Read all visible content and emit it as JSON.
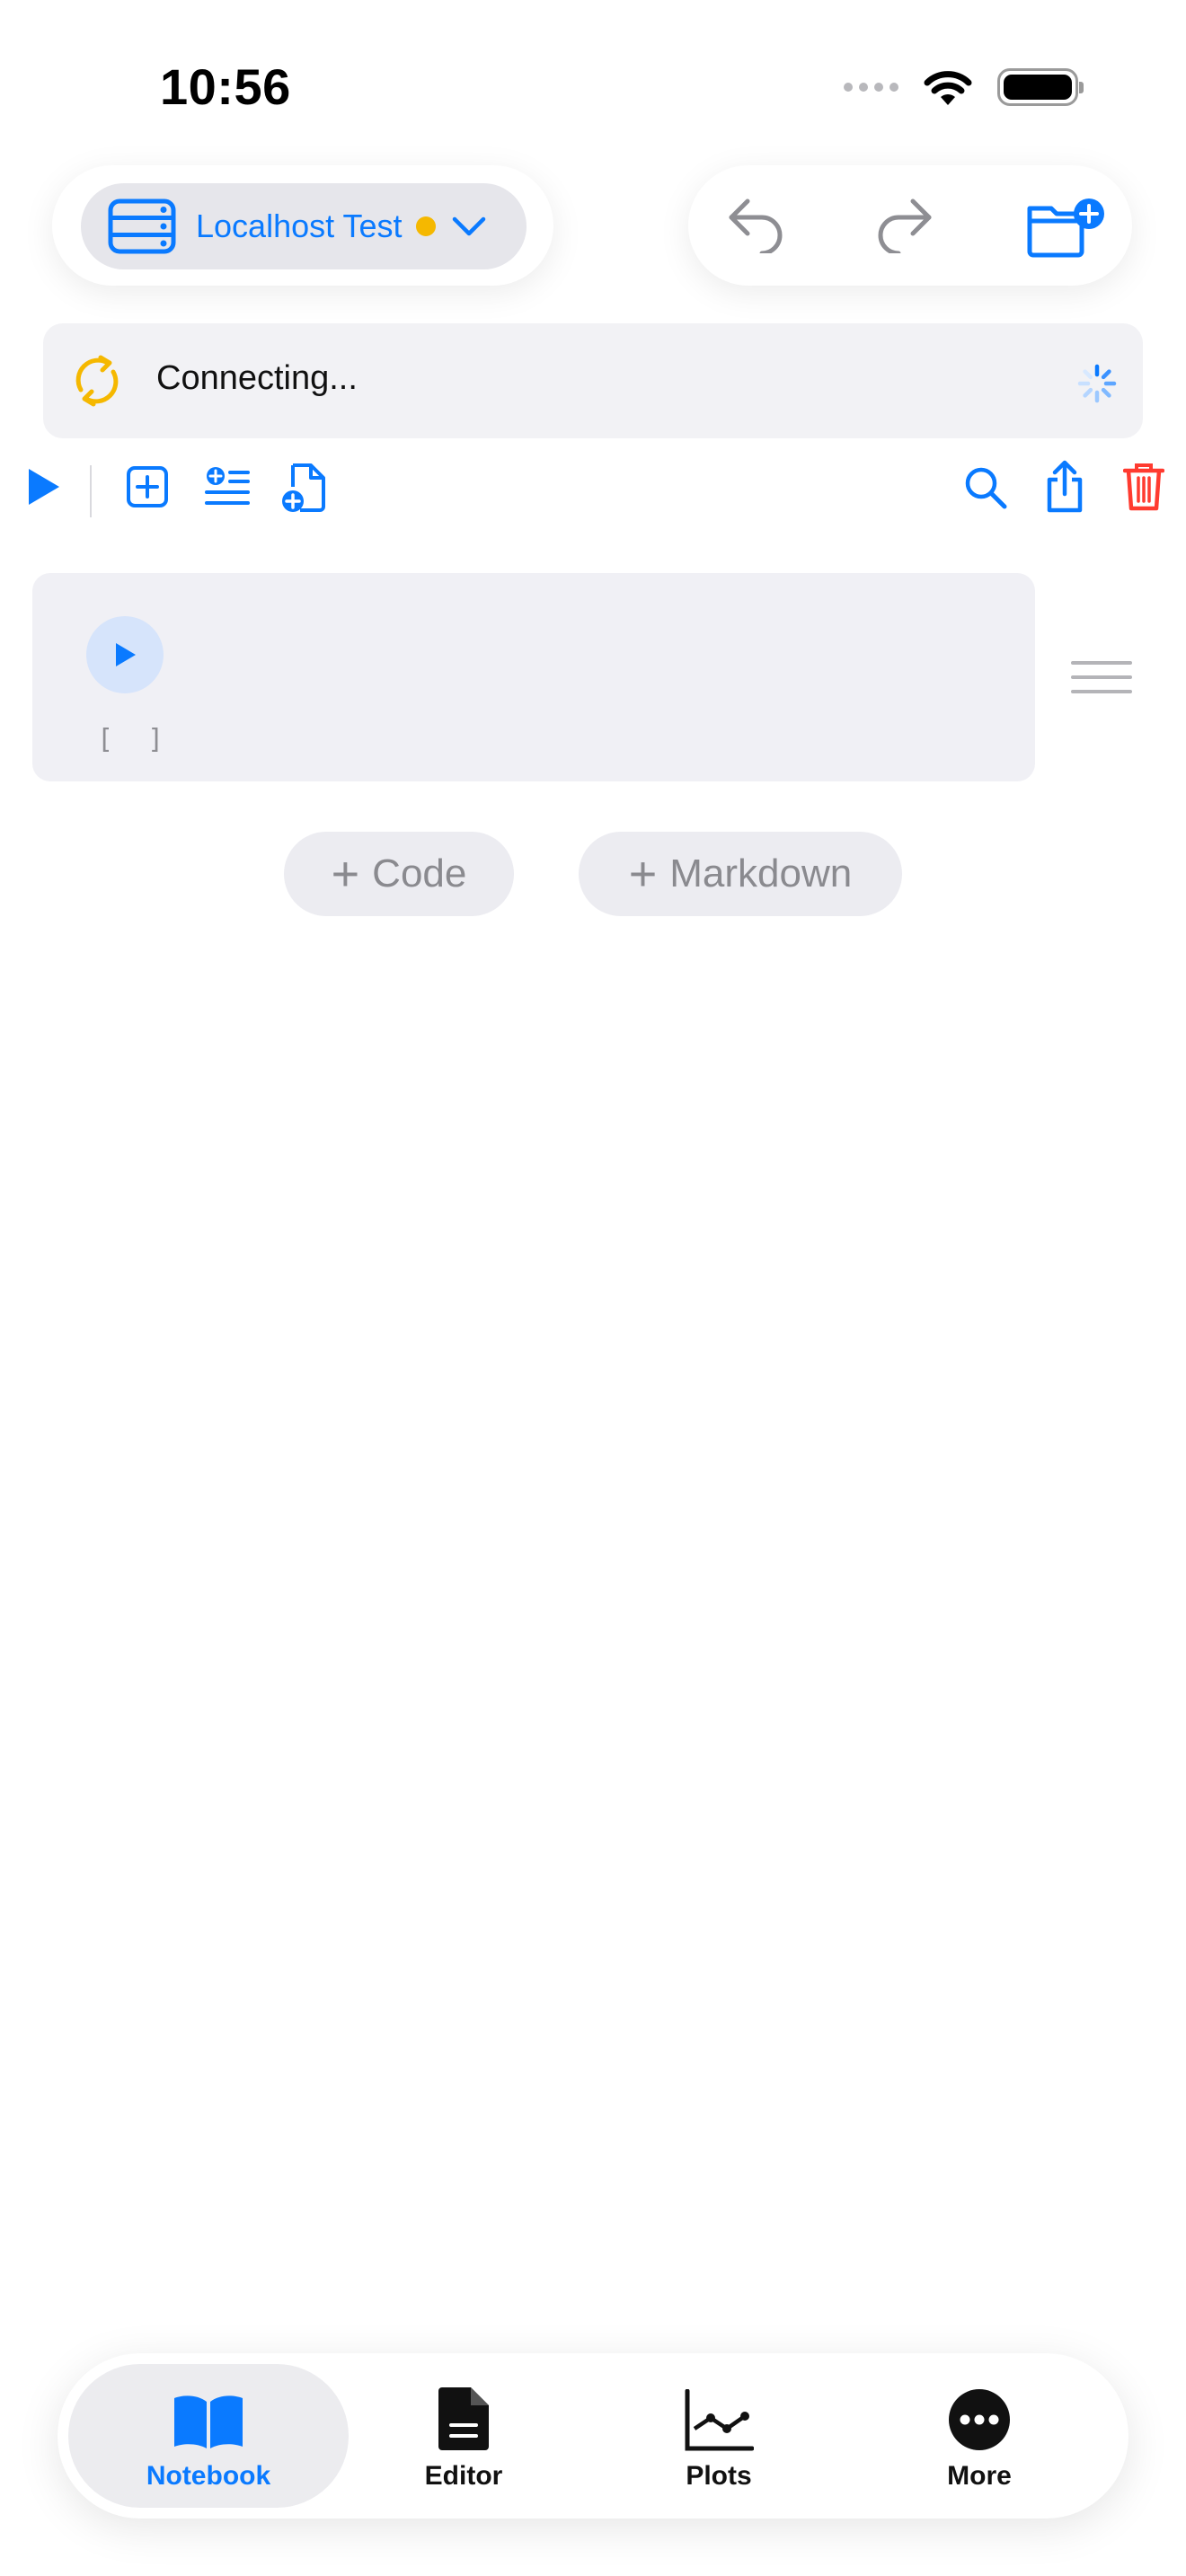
{
  "status_bar": {
    "time": "10:56"
  },
  "server": {
    "name": "Localhost Test",
    "status_color": "#f5b800"
  },
  "connection": {
    "status_text": "Connecting..."
  },
  "cell": {
    "execution_count": "[ ]"
  },
  "add_cell": {
    "code_label": "Code",
    "markdown_label": "Markdown"
  },
  "tabs": [
    {
      "label": "Notebook",
      "icon": "book-icon",
      "active": true
    },
    {
      "label": "Editor",
      "icon": "document-icon",
      "active": false
    },
    {
      "label": "Plots",
      "icon": "chart-icon",
      "active": false
    },
    {
      "label": "More",
      "icon": "ellipsis-circle-icon",
      "active": false
    }
  ],
  "colors": {
    "accent": "#0a7aff",
    "warning": "#f5b800",
    "danger": "#ff3b30"
  }
}
